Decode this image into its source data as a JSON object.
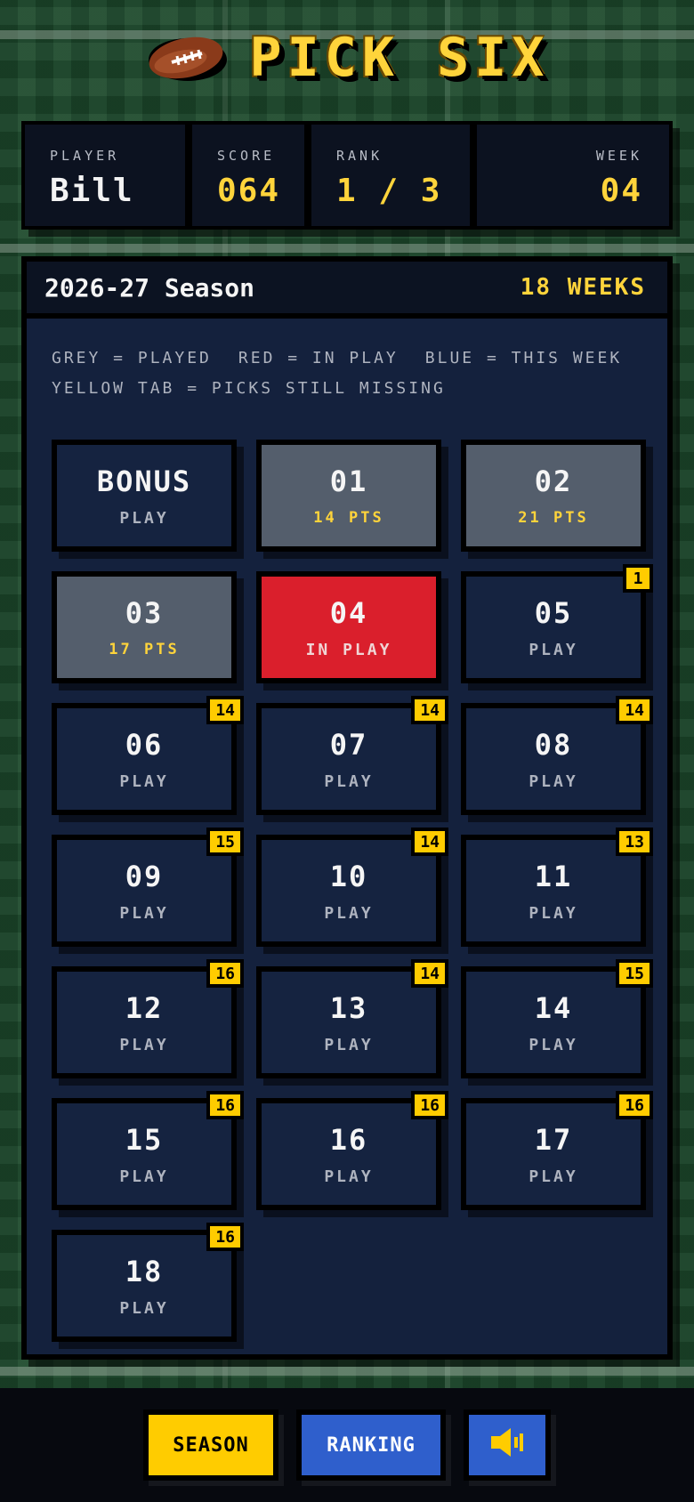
{
  "app": {
    "title": "PICK SIX"
  },
  "stats": {
    "player_label": "PLAYER",
    "player_value": "Bill",
    "score_label": "SCORE",
    "score_value": "064",
    "rank_label": "RANK",
    "rank_value": "1 / 3",
    "week_label": "WEEK",
    "week_value": "04"
  },
  "season": {
    "name": "2026-27 Season",
    "weeks_label": "18 WEEKS",
    "legend": {
      "played": "GREY = PLAYED",
      "in_play": "RED = IN PLAY",
      "this_week": "BLUE = THIS WEEK",
      "missing": "YELLOW TAB = PICKS STILL MISSING"
    }
  },
  "tiles": [
    {
      "num": "BONUS",
      "sub": "PLAY",
      "state": "open",
      "badge": ""
    },
    {
      "num": "01",
      "sub": "14 PTS",
      "state": "played",
      "badge": ""
    },
    {
      "num": "02",
      "sub": "21 PTS",
      "state": "played",
      "badge": ""
    },
    {
      "num": "03",
      "sub": "17 PTS",
      "state": "played",
      "badge": ""
    },
    {
      "num": "04",
      "sub": "IN PLAY",
      "state": "inplay",
      "badge": ""
    },
    {
      "num": "05",
      "sub": "PLAY",
      "state": "open",
      "badge": "1"
    },
    {
      "num": "06",
      "sub": "PLAY",
      "state": "open",
      "badge": "14"
    },
    {
      "num": "07",
      "sub": "PLAY",
      "state": "open",
      "badge": "14"
    },
    {
      "num": "08",
      "sub": "PLAY",
      "state": "open",
      "badge": "14"
    },
    {
      "num": "09",
      "sub": "PLAY",
      "state": "open",
      "badge": "15"
    },
    {
      "num": "10",
      "sub": "PLAY",
      "state": "open",
      "badge": "14"
    },
    {
      "num": "11",
      "sub": "PLAY",
      "state": "open",
      "badge": "13"
    },
    {
      "num": "12",
      "sub": "PLAY",
      "state": "open",
      "badge": "16"
    },
    {
      "num": "13",
      "sub": "PLAY",
      "state": "open",
      "badge": "14"
    },
    {
      "num": "14",
      "sub": "PLAY",
      "state": "open",
      "badge": "15"
    },
    {
      "num": "15",
      "sub": "PLAY",
      "state": "open",
      "badge": "16"
    },
    {
      "num": "16",
      "sub": "PLAY",
      "state": "open",
      "badge": "16"
    },
    {
      "num": "17",
      "sub": "PLAY",
      "state": "open",
      "badge": "16"
    },
    {
      "num": "18",
      "sub": "PLAY",
      "state": "open",
      "badge": "16"
    }
  ],
  "nav": {
    "season_label": "SEASON",
    "ranking_label": "RANKING",
    "sound_icon": "speaker-icon"
  },
  "colors": {
    "accent_yellow": "#ffcc00",
    "played_grey": "#545e6c",
    "in_play_red": "#da1f2c",
    "open_blue": "#152340",
    "button_blue": "#2f5fcc"
  }
}
